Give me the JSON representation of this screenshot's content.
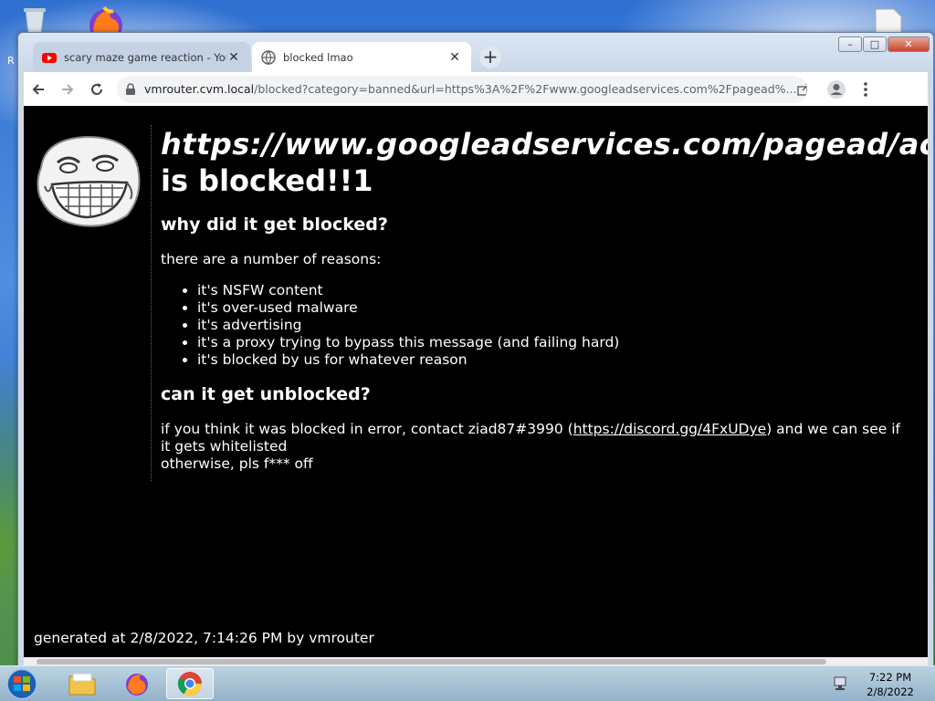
{
  "desktop": {
    "visible_letter": "R"
  },
  "browser": {
    "tabs": [
      {
        "title": "scary maze game reaction - YouT",
        "favicon": "youtube-icon",
        "active": false
      },
      {
        "title": "blocked lmao",
        "favicon": "globe-icon",
        "active": true
      }
    ],
    "new_tab_label": "+",
    "window_controls": {
      "minimize": "–",
      "maximize": "□",
      "close": "✕"
    },
    "address": {
      "host": "vmrouter.cvm.local",
      "path": "/blocked?category=banned&url=https%3A%2F%2Fwww.googleadservices.com%2Fpagead%..."
    }
  },
  "page": {
    "blocked_url": "https://www.googleadservices.com/pagead/aclk?sa=L&ai=",
    "blocked_suffix": "is blocked!!1",
    "why_heading": "why did it get blocked?",
    "reasons_intro": "there are a number of reasons:",
    "reasons": [
      "it's NSFW content",
      "it's over-used malware",
      "it's advertising",
      "it's a proxy trying to bypass this message (and failing hard)",
      "it's blocked by us for whatever reason"
    ],
    "unblock_heading": "can it get unblocked?",
    "contact_before": "if you think it was blocked in error, contact ziad87#3990 (",
    "contact_link": "https://discord.gg/4FxUDye",
    "contact_after": ") and we can see if it gets whitelisted",
    "closing": "otherwise, pls f*** off",
    "footer": "generated at 2/8/2022, 7:14:26 PM by vmrouter"
  },
  "taskbar": {
    "items": [
      "start-orb",
      "file-explorer",
      "firefox",
      "chrome"
    ],
    "active_item": "chrome",
    "clock_time": "7:22 PM",
    "clock_date": "2/8/2022"
  },
  "colors": {
    "page_background": "#000000",
    "page_text": "#ffffff",
    "tab_active": "#ffffff",
    "tab_inactive": "#c4d2e4"
  }
}
